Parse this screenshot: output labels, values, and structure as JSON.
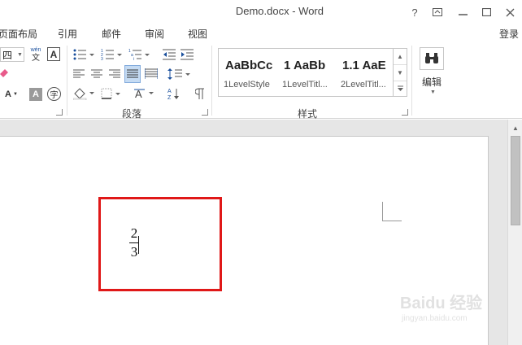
{
  "window": {
    "title": "Demo.docx - Word",
    "help": "?",
    "ribbon_display": "⊼",
    "minimize": "—",
    "maximize": "☐",
    "close": "✕",
    "sign_in": "登录"
  },
  "menu_tabs": [
    "页面布局",
    "引用",
    "邮件",
    "审阅",
    "视图"
  ],
  "ribbon": {
    "font_size_value": "四",
    "phonetic_top": "wén",
    "phonetic_bottom": "文",
    "char_border": "A",
    "text_effect": "A",
    "char_shading": "A",
    "enclose_char": "字",
    "paragraph_group_label": "段落",
    "styles_group_label": "样式",
    "editing_label": "编辑",
    "styles": [
      {
        "preview": "AaBbCc",
        "name": "1LevelStyle"
      },
      {
        "preview": "1  AaBb",
        "name": "1LevelTitl..."
      },
      {
        "preview": "1.1  AaE",
        "name": "2LevelTitl..."
      }
    ]
  },
  "document": {
    "fraction_numerator": "2",
    "fraction_denominator": "3"
  },
  "watermark": {
    "brand": "Baidu 经验",
    "url": "jingyan.baidu.com"
  },
  "colors": {
    "highlight_border": "#e01818",
    "selected_button": "#c5dbf3"
  }
}
